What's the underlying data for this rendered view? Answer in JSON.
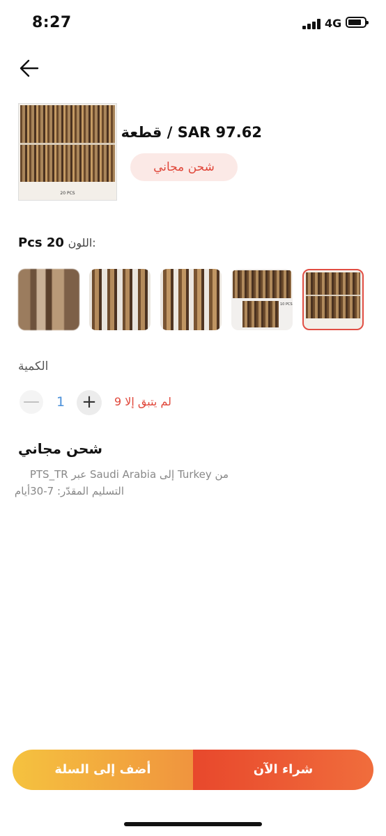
{
  "status_bar": {
    "time": "8:27",
    "network": "4G"
  },
  "product": {
    "price": "SAR 97.62 / قطعة",
    "shipping_badge": "شحن مجاني",
    "image_caption": "20 PCS"
  },
  "variant": {
    "label": "اللون:",
    "value": "Pcs 20",
    "options": [
      "blurred close-up",
      "4 pcs",
      "4 pcs",
      "10 pcs",
      "20 pcs"
    ],
    "selected_index": 4,
    "option4_caption": "10 PCS"
  },
  "quantity": {
    "label": "الكمية",
    "value": "1",
    "minus": "—",
    "plus": "+",
    "stock_note": "لم يتبق إلا 9"
  },
  "shipping": {
    "title": "شحن مجاني",
    "route": "من Turkey إلى Saudi Arabia عبر PTS_TR",
    "eta": "التسليم المقدّر: 7-30أيام"
  },
  "actions": {
    "add_to_cart": "أضف إلى السلة",
    "buy_now": "شراء الآن"
  },
  "colors": {
    "accent": "#e0473a",
    "cart_gradient": [
      "#f5c23f",
      "#f0943e"
    ],
    "buy_gradient": [
      "#e8482c",
      "#f06d3c"
    ]
  }
}
